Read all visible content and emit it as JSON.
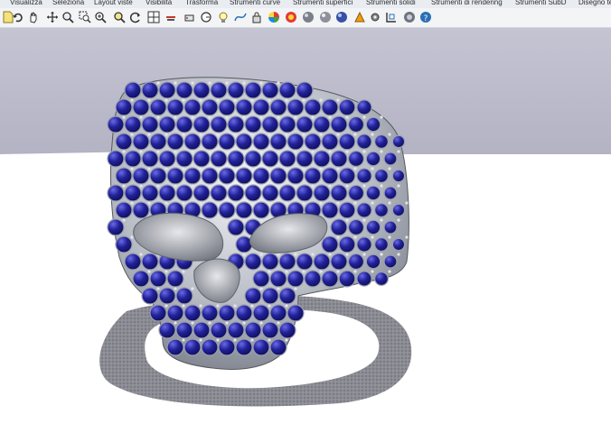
{
  "menu": {
    "tabs": [
      {
        "label": "Visualizza"
      },
      {
        "label": "Seleziona"
      },
      {
        "label": "Layout viste"
      },
      {
        "label": "Visibilità"
      },
      {
        "label": "Trasforma"
      },
      {
        "label": "Strumenti curve"
      },
      {
        "label": "Strumenti superfici"
      },
      {
        "label": "Strumenti solidi"
      },
      {
        "label": "Strumenti di rendering"
      },
      {
        "label": "Strumenti SubD"
      },
      {
        "label": "Disegno te"
      }
    ]
  },
  "toolbar": {
    "icons": [
      "new-file-icon",
      "undo-icon",
      "pan-hand-icon",
      "move-arrows-icon",
      "zoom-icon",
      "zoom-window-icon",
      "zoom-extents-icon",
      "zoom-selected-icon",
      "rotate-view-icon",
      "viewport-grid-icon",
      "cut-icon",
      "named-view-icon",
      "set-cplane-icon",
      "lightbulb-icon",
      "curve-select-icon",
      "lock-icon",
      "color-wheel-icon",
      "material-icon",
      "render-sphere-icon",
      "shaded-sphere-icon",
      "rendered-sphere-icon",
      "blue-sphere-icon",
      "gear-options-icon",
      "snap-icon",
      "environment-icon",
      "help-icon"
    ]
  },
  "scene": {
    "background_color": "#b8b8c8",
    "floor_color": "#ffffff",
    "gem_color": "#1c1c8a",
    "metal_color": "#c8ccd4"
  }
}
